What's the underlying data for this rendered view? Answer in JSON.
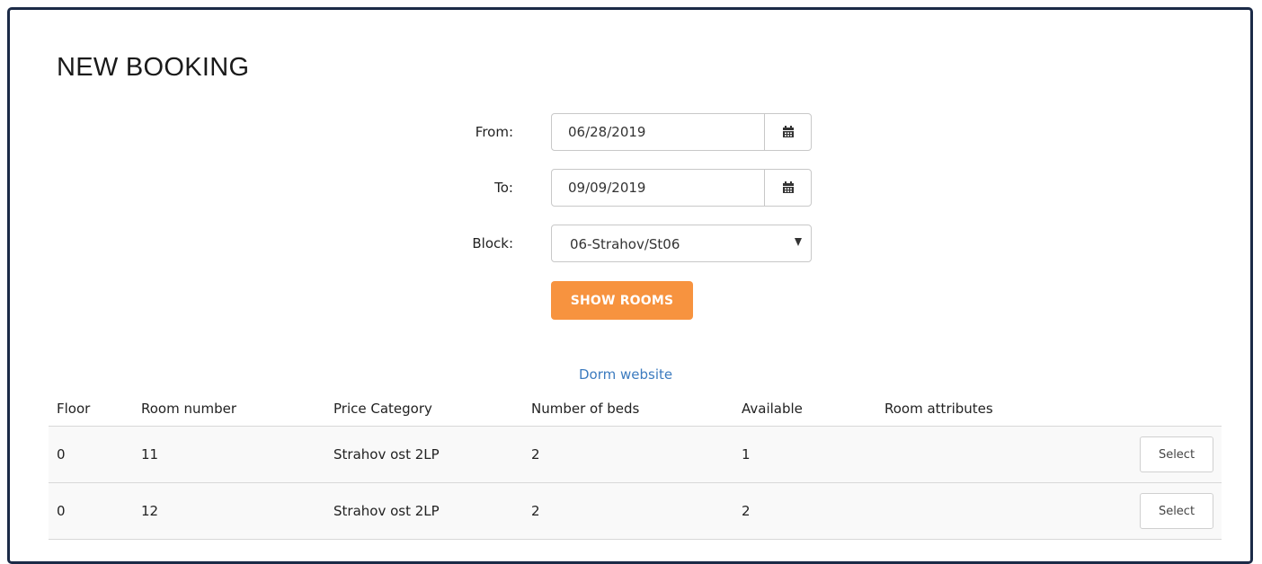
{
  "page": {
    "title": "NEW BOOKING"
  },
  "form": {
    "from_label": "From:",
    "from_value": "06/28/2019",
    "to_label": "To:",
    "to_value": "09/09/2019",
    "block_label": "Block:",
    "block_value": "06-Strahov/St06",
    "show_rooms_label": "SHOW ROOMS",
    "dorm_link": "Dorm website"
  },
  "icons": {
    "from_picker": "calendar-icon",
    "to_picker": "calendar-icon",
    "block_dropdown": "caret-down-icon"
  },
  "colors": {
    "frame_border": "#1b2a47",
    "primary_button": "#f7933f",
    "link": "#3c7bbf"
  },
  "table": {
    "headers": [
      "Floor",
      "Room number",
      "Price Category",
      "Number of beds",
      "Available",
      "Room attributes"
    ],
    "rows": [
      {
        "floor": "0",
        "room": "11",
        "price": "Strahov ost 2LP",
        "beds": "2",
        "available": "1",
        "attributes": "",
        "action": "Select"
      },
      {
        "floor": "0",
        "room": "12",
        "price": "Strahov ost 2LP",
        "beds": "2",
        "available": "2",
        "attributes": "",
        "action": "Select"
      }
    ]
  }
}
